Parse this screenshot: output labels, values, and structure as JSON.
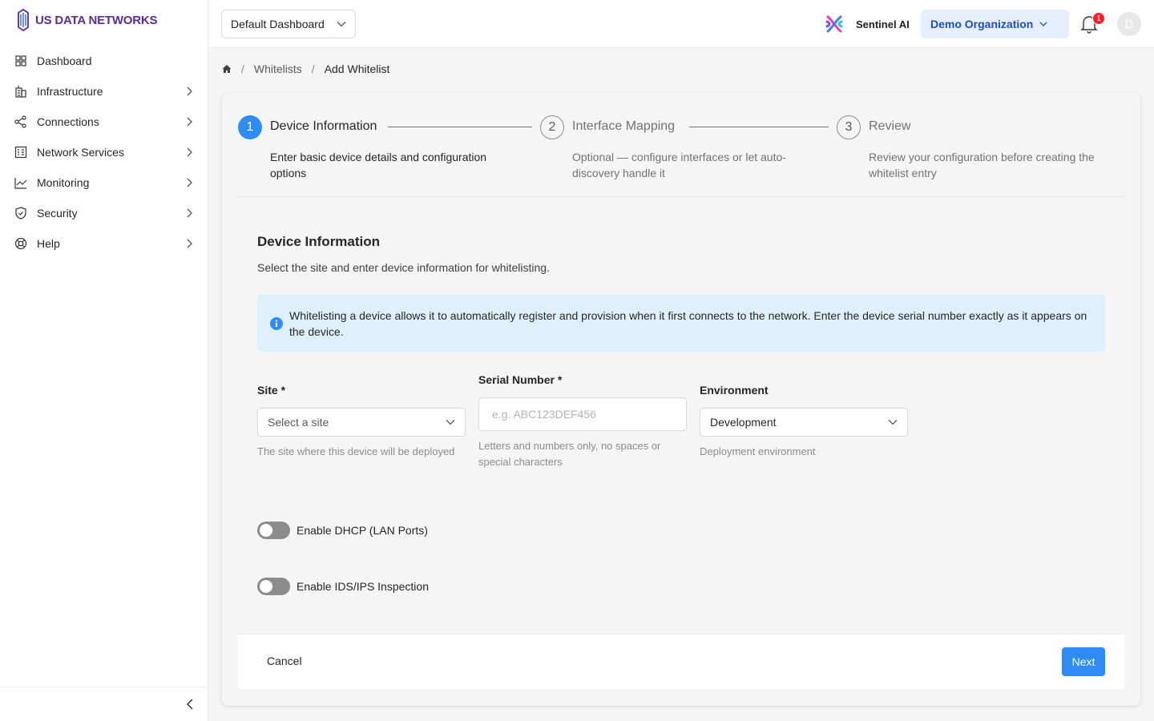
{
  "brand": {
    "name": "US DATA NETWORKS",
    "color": "#5b2d8e"
  },
  "sidebar": {
    "items": [
      {
        "label": "Dashboard",
        "icon": "grid-icon",
        "has_children": false
      },
      {
        "label": "Infrastructure",
        "icon": "building-icon",
        "has_children": true
      },
      {
        "label": "Connections",
        "icon": "share-nodes-icon",
        "has_children": true
      },
      {
        "label": "Network Services",
        "icon": "server-icon",
        "has_children": true
      },
      {
        "label": "Monitoring",
        "icon": "line-chart-icon",
        "has_children": true
      },
      {
        "label": "Security",
        "icon": "shield-icon",
        "has_children": true
      },
      {
        "label": "Help",
        "icon": "lifebuoy-icon",
        "has_children": true
      }
    ],
    "collapse_icon": "chevron-left-icon"
  },
  "header": {
    "dashboard_select": "Default Dashboard",
    "sentinel_label": "Sentinel AI",
    "org_select": "Demo Organization",
    "notification_count": "1",
    "avatar_initial": "D"
  },
  "breadcrumb": {
    "items": [
      "Whitelists",
      "Add Whitelist"
    ]
  },
  "steps": [
    {
      "number": "1",
      "title": "Device Information",
      "description": "Enter basic device details and configuration options",
      "active": true
    },
    {
      "number": "2",
      "title": "Interface Mapping",
      "description": "Optional — configure interfaces or let auto-discovery handle it",
      "active": false
    },
    {
      "number": "3",
      "title": "Review",
      "description": "Review your configuration before creating the whitelist entry",
      "active": false
    }
  ],
  "form": {
    "title": "Device Information",
    "subtitle": "Select the site and enter device information for whitelisting.",
    "info": "Whitelisting a device allows it to automatically register and provision when it first connects to the network. Enter the device serial number exactly as it appears on the device.",
    "site": {
      "label": "Site",
      "required_mark": "*",
      "placeholder": "Select a site",
      "help": "The site where this device will be deployed"
    },
    "serial": {
      "label": "Serial Number",
      "required_mark": "*",
      "placeholder": "e.g. ABC123DEF456",
      "value": "",
      "help": "Letters and numbers only, no spaces or special characters"
    },
    "environment": {
      "label": "Environment",
      "value": "Development",
      "help": "Deployment environment"
    },
    "toggles": [
      {
        "label": "Enable DHCP (LAN Ports)",
        "enabled": false
      },
      {
        "label": "Enable IDS/IPS Inspection",
        "enabled": false
      }
    ]
  },
  "footer": {
    "cancel_label": "Cancel",
    "next_label": "Next"
  },
  "colors": {
    "primary": "#2f8cf3",
    "info_bg": "#dff0fd",
    "org_text": "#1d4fb8",
    "badge": "#f5222d"
  }
}
